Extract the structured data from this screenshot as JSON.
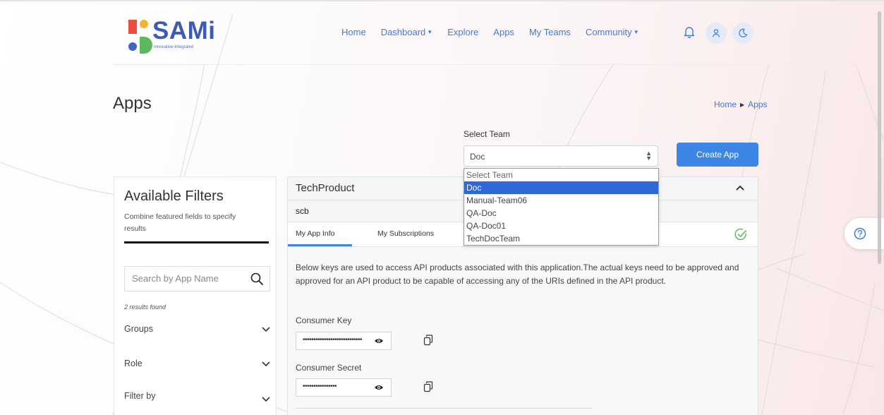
{
  "brand": {
    "name": "SAMi",
    "tagline": "Innovative-Integrated"
  },
  "nav": {
    "items": [
      {
        "label": "Home",
        "dropdown": false
      },
      {
        "label": "Dashboard",
        "dropdown": true
      },
      {
        "label": "Explore",
        "dropdown": false
      },
      {
        "label": "Apps",
        "dropdown": false
      },
      {
        "label": "My Teams",
        "dropdown": false
      },
      {
        "label": "Community",
        "dropdown": true
      }
    ],
    "icons": [
      "bell-icon",
      "user-icon",
      "moon-icon"
    ]
  },
  "page": {
    "title": "Apps",
    "breadcrumb": {
      "home": "Home",
      "current": "Apps"
    }
  },
  "team_select": {
    "label": "Select Team",
    "value": "Doc",
    "options": [
      "Select Team",
      "Doc",
      "Manual-Team06",
      "QA-Doc",
      "QA-Doc01",
      "TechDocTeam"
    ],
    "selected_index": 1
  },
  "actions": {
    "create_app": "Create App"
  },
  "filters": {
    "title": "Available Filters",
    "subtitle": "Combine featured fields to specify results",
    "search_placeholder": "Search by App Name",
    "results": "2 results found",
    "groups": [
      {
        "label": "Groups"
      },
      {
        "label": "Role"
      },
      {
        "label": "Filter by"
      }
    ]
  },
  "app": {
    "name": "TechProduct",
    "id": "scb",
    "tabs": [
      "My App Info",
      "My Subscriptions"
    ],
    "active_tab": 0,
    "description": "Below keys are used to access API products associated with this application.The actual keys need to be approved and approved for an API product to be capable of accessing any of the URIs defined in the API product.",
    "consumer_key": {
      "label": "Consumer Key",
      "masked": "••••••••••••••••••••••••••••"
    },
    "consumer_secret": {
      "label": "Consumer Secret",
      "masked": "••••••••••••••••"
    }
  },
  "colors": {
    "accent": "#3e86e6",
    "nav": "#3d7ae3",
    "selected_option": "#2f69d8",
    "status_ok": "#58b85c"
  }
}
